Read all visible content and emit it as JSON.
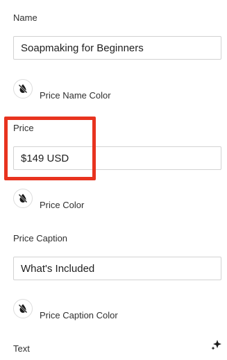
{
  "fields": {
    "name": {
      "label": "Name",
      "value": "Soapmaking for Beginners"
    },
    "price_name_color": {
      "label": "Price Name Color",
      "icon": "no-color-drop-icon"
    },
    "price": {
      "label": "Price",
      "value": "$149 USD"
    },
    "price_color": {
      "label": "Price Color",
      "icon": "no-color-drop-icon"
    },
    "price_caption": {
      "label": "Price Caption",
      "value": "What's Included"
    },
    "price_caption_color": {
      "label": "Price Caption Color",
      "icon": "no-color-drop-icon"
    },
    "text": {
      "label": "Text",
      "icon": "sparkle-icon"
    }
  },
  "colors": {
    "highlight": "#e8331f",
    "border": "#d2d2d2",
    "text": "#2f2f2f"
  }
}
